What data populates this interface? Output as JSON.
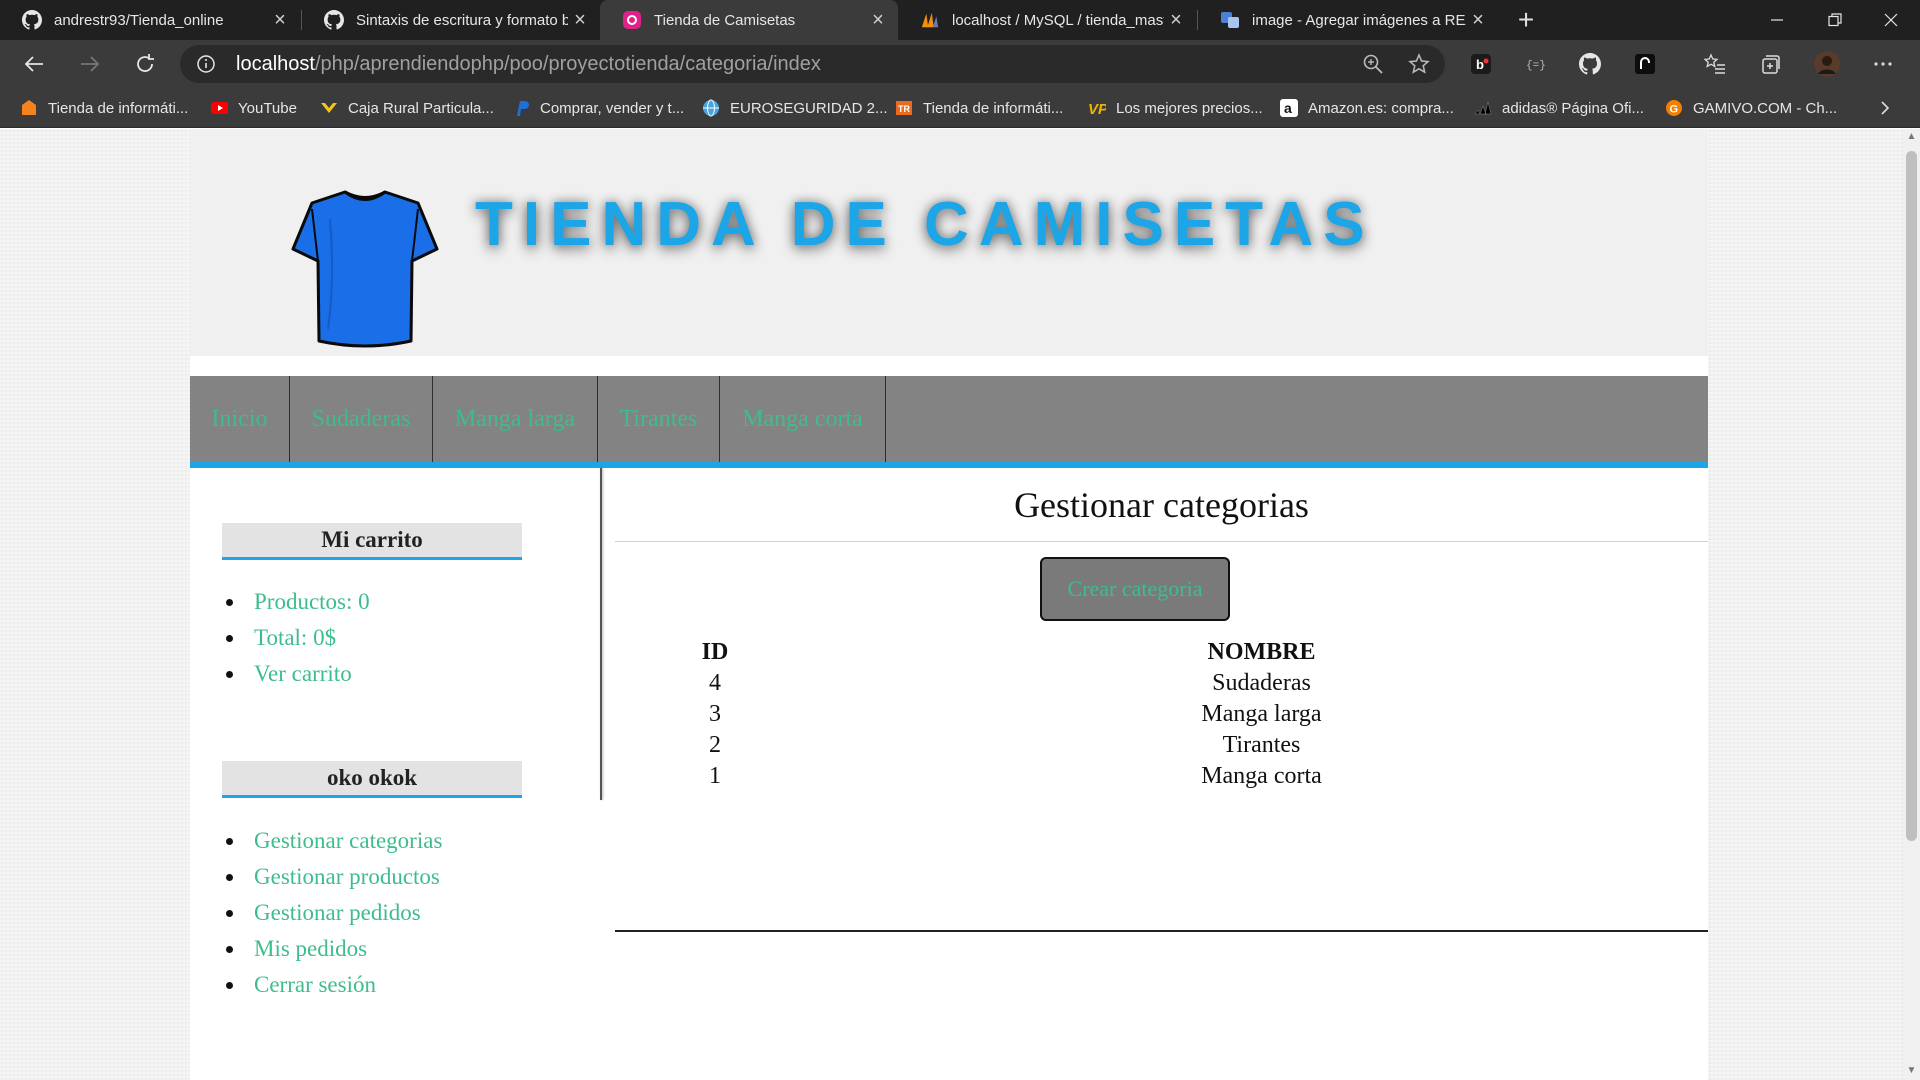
{
  "browser": {
    "tabs": [
      {
        "title": "andrestr93/Tienda_online",
        "icon": "github-icon",
        "active": false
      },
      {
        "title": "Sintaxis de escritura y formato básicos",
        "icon": "github-icon",
        "active": false
      },
      {
        "title": "Tienda de Camisetas",
        "icon": "page-icon",
        "active": true
      },
      {
        "title": "localhost / MySQL / tienda_master",
        "icon": "phpmyadmin-icon",
        "active": false
      },
      {
        "title": "image - Agregar imágenes a README",
        "icon": "translate-icon",
        "active": false
      }
    ],
    "close_glyph": "×",
    "new_tab_glyph": "+",
    "url_host": "localhost",
    "url_path": "/php/aprendiendophp/poo/proyectotienda/categoria/index",
    "bookmarks": [
      {
        "label": "Tienda de informáti...",
        "icon": "shop-icon",
        "color": "#f5821f"
      },
      {
        "label": "YouTube",
        "icon": "youtube-icon",
        "color": "#ff0000"
      },
      {
        "label": "Caja Rural Particula...",
        "icon": "bank-icon",
        "color": "#f5c518"
      },
      {
        "label": "Comprar, vender y t...",
        "icon": "paypal-icon",
        "color": "#1e6fd9"
      },
      {
        "label": "EUROSEGURIDAD 2...",
        "icon": "globe-icon",
        "color": "#4aa3df"
      },
      {
        "label": "Tienda de informáti...",
        "icon": "shop-icon",
        "color": "#e86b1f"
      },
      {
        "label": "Los mejores precios...",
        "icon": "vp-icon",
        "color": "#f0b400"
      },
      {
        "label": "Amazon.es: compra...",
        "icon": "amazon-icon",
        "color": "#ffffff"
      },
      {
        "label": "adidas® Página Ofi...",
        "icon": "adidas-icon",
        "color": "#000000"
      },
      {
        "label": "GAMIVO.COM - Ch...",
        "icon": "gamivo-icon",
        "color": "#f77f00"
      }
    ]
  },
  "site": {
    "title": "TIENDA DE CAMISETAS",
    "accent": "#1ca5e7",
    "link_color": "#3ebd8c",
    "menu": [
      "Inicio",
      "Sudaderas",
      "Manga larga",
      "Tirantes",
      "Manga corta"
    ]
  },
  "sidebar": {
    "cart_title": "Mi carrito",
    "cart_items": [
      "Productos: 0",
      "Total: 0$",
      "Ver carrito"
    ],
    "user_title": "oko okok",
    "user_items": [
      "Gestionar categorias",
      "Gestionar productos",
      "Gestionar pedidos",
      "Mis pedidos",
      "Cerrar sesión"
    ]
  },
  "main": {
    "title": "Gestionar categorias",
    "create_button": "Crear categoria",
    "columns": [
      "ID",
      "NOMBRE"
    ],
    "rows": [
      {
        "id": "4",
        "nombre": "Sudaderas"
      },
      {
        "id": "3",
        "nombre": "Manga larga"
      },
      {
        "id": "2",
        "nombre": "Tirantes"
      },
      {
        "id": "1",
        "nombre": "Manga corta"
      }
    ]
  }
}
